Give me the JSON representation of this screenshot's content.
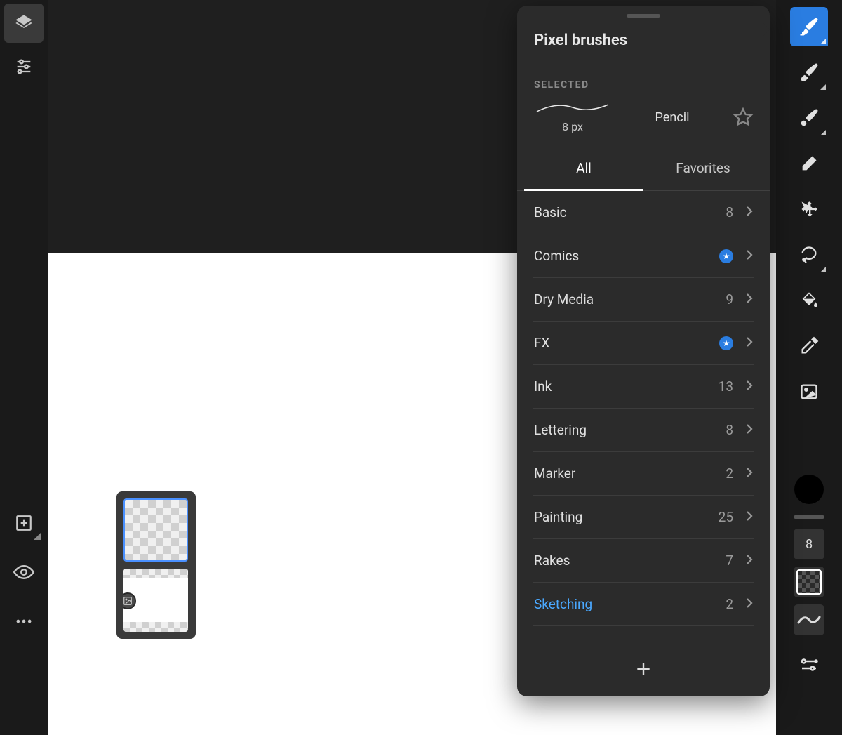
{
  "panel": {
    "title": "Pixel brushes",
    "selected_label": "SELECTED",
    "selected_brush_name": "Pencil",
    "selected_brush_size": "8 px",
    "tabs": {
      "all": "All",
      "favorites": "Favorites"
    },
    "categories": [
      {
        "name": "Basic",
        "count": "8",
        "premium": false,
        "current": false
      },
      {
        "name": "Comics",
        "count": "",
        "premium": true,
        "current": false
      },
      {
        "name": "Dry Media",
        "count": "9",
        "premium": false,
        "current": false
      },
      {
        "name": "FX",
        "count": "",
        "premium": true,
        "current": false
      },
      {
        "name": "Ink",
        "count": "13",
        "premium": false,
        "current": false
      },
      {
        "name": "Lettering",
        "count": "8",
        "premium": false,
        "current": false
      },
      {
        "name": "Marker",
        "count": "2",
        "premium": false,
        "current": false
      },
      {
        "name": "Painting",
        "count": "25",
        "premium": false,
        "current": false
      },
      {
        "name": "Rakes",
        "count": "7",
        "premium": false,
        "current": false
      },
      {
        "name": "Sketching",
        "count": "2",
        "premium": false,
        "current": true
      }
    ]
  },
  "right_toolbar": {
    "brush_size_value": "8"
  }
}
